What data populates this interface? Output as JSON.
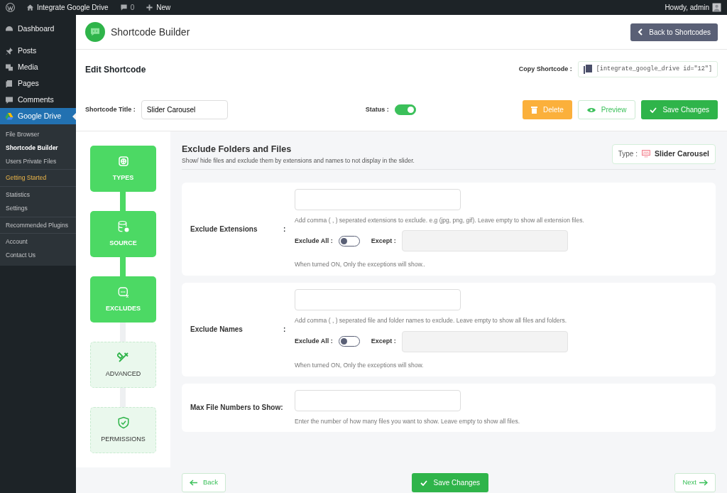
{
  "admin_bar": {
    "site": "Integrate Google Drive",
    "comments": "0",
    "new": "New",
    "greeting": "Howdy, admin"
  },
  "sidebar": {
    "menu": [
      {
        "label": "Dashboard",
        "selected": false
      },
      {
        "label": "Posts",
        "selected": false
      },
      {
        "label": "Media",
        "selected": false
      },
      {
        "label": "Pages",
        "selected": false
      },
      {
        "label": "Comments",
        "selected": false
      },
      {
        "label": "Google Drive",
        "selected": true
      }
    ],
    "submenu_groups": [
      [
        {
          "label": "File Browser",
          "kind": "link",
          "selected": false
        },
        {
          "label": "Shortcode Builder",
          "kind": "link",
          "selected": true
        },
        {
          "label": "Users Private Files",
          "kind": "link",
          "selected": false
        }
      ],
      [
        {
          "label": "Getting Started",
          "kind": "promo",
          "selected": false
        }
      ],
      [
        {
          "label": "Statistics",
          "kind": "link",
          "selected": false
        },
        {
          "label": "Settings",
          "kind": "link",
          "selected": false
        }
      ],
      [
        {
          "label": "Recommended Plugins",
          "kind": "link",
          "selected": false
        }
      ],
      [
        {
          "label": "Account",
          "kind": "link",
          "selected": false
        },
        {
          "label": "Contact Us",
          "kind": "link",
          "selected": false
        }
      ]
    ]
  },
  "header": {
    "title": "Shortcode Builder",
    "back_button": "Back to Shortcodes"
  },
  "editor": {
    "title": "Edit Shortcode",
    "copy_label": "Copy Shortcode :",
    "shortcode": "[integrate_google_drive id=\"12\"]",
    "title_label": "Shortcode Title :",
    "title_value": "Slider Carousel",
    "status_label": "Status :",
    "status_on": true,
    "buttons": {
      "delete": "Delete",
      "preview": "Preview",
      "save": "Save Changes"
    }
  },
  "steps": [
    {
      "label": "TYPES",
      "completed": true
    },
    {
      "label": "SOURCE",
      "completed": true
    },
    {
      "label": "EXCLUDES",
      "completed": true
    },
    {
      "label": "ADVANCED",
      "completed": false
    },
    {
      "label": "PERMISSIONS",
      "completed": false
    }
  ],
  "section": {
    "title": "Exclude Folders and Files",
    "subtitle": "Show/ hide files and exclude them by extensions and names to not display in the slider.",
    "type_label": "Type :",
    "type_value": "Slider Carousel"
  },
  "fields": [
    {
      "kind": "exclude",
      "label": "Exclude Extensions",
      "colon": ":",
      "hint": "Add comma ( , ) seperated extensions to exclude. e.g (jpg, png, gif). Leave empty to show all extension files.",
      "exclude_all_label": "Exclude All :",
      "exclude_all_on": false,
      "except_label": "Except :",
      "note": "When turned ON, Only the exceptions will show.."
    },
    {
      "kind": "exclude",
      "label": "Exclude Names",
      "colon": ":",
      "hint": "Add comma ( , ) seperated file and folder names to exclude. Leave empty to show all files and folders.",
      "exclude_all_label": "Exclude All :",
      "exclude_all_on": false,
      "except_label": "Except :",
      "note": "When turned ON, Only the exceptions will show."
    },
    {
      "kind": "number",
      "label": "Max File Numbers to Show:",
      "hint": "Enter the number of how many files you want to show. Leave empty to show all files."
    }
  ],
  "footer": {
    "back": "Back",
    "save": "Save Changes",
    "next": "Next"
  }
}
